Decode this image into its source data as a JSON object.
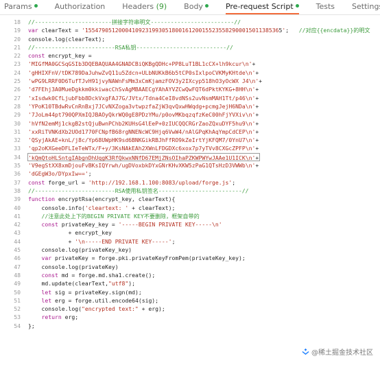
{
  "tabs": [
    {
      "label": "Params",
      "active": false,
      "dot": true
    },
    {
      "label": "Authorization",
      "active": false
    },
    {
      "label": "Headers",
      "count": "(9)",
      "active": false
    },
    {
      "label": "Body",
      "active": false,
      "dot": true
    },
    {
      "label": "Pre-request Script",
      "active": true,
      "dot": true
    },
    {
      "label": "Tests",
      "active": false
    },
    {
      "label": "Settings",
      "active": false
    }
  ],
  "code_lines": [
    {
      "n": 18,
      "parts": [
        [
          "cm",
          "//-----------------------拼接字符串明文-------------------------//"
        ]
      ]
    },
    {
      "n": 19,
      "parts": [
        [
          "kw",
          "var"
        ],
        [
          "",
          " clearText = "
        ],
        [
          "str",
          "'1554790512000410923199305180016120015523558290001501138536"
        ],
        [
          "",
          "5"
        ],
        [
          "str",
          "'"
        ],
        [
          "",
          ";   "
        ],
        [
          "cm",
          "//对应{{encdata}}的明文"
        ]
      ]
    },
    {
      "n": 20,
      "parts": [
        [
          "",
          "console.log(clearText);"
        ]
      ]
    },
    {
      "n": 21,
      "parts": [
        [
          "cm",
          "//------------------------RSA私钥---------------------------//"
        ]
      ]
    },
    {
      "n": 22,
      "parts": [
        [
          "kw",
          "const"
        ],
        [
          "",
          " encrypt_key ="
        ]
      ]
    },
    {
      "n": 23,
      "parts": [
        [
          "str",
          "'MIGfMA0GCSqGSIb3DQEBAQUAA4GNADCBiQKBgQDHc+PP8LuT1BL1cCX+lh9kcur\\n'"
        ],
        [
          "",
          "+"
        ]
      ]
    },
    {
      "n": 24,
      "parts": [
        [
          "str",
          "'gHHIXFnV/tDK789DaJuhwZvQ11u5Zdcn+ULbNUKkB6b5tCP0sIxlpoCVKMyKHtde\\n'"
        ],
        [
          "",
          "+"
        ]
      ]
    },
    {
      "n": 25,
      "parts": [
        [
          "str",
          "'wPG9LRRF0D6TufTJvH91jvyNAWnFsMm3xCmKjamzFOV3y2IXcyp518hO3yOcWX J4\\n'"
        ],
        [
          "",
          "+"
        ]
      ]
    },
    {
      "n": 26,
      "parts": [
        [
          "str",
          "'d7FEhj3A0MueDgkkm0kkiwacChSvAgMBAAECgYAhAYVZCwQwFQT6dPktKYKG+8HH\\n'"
        ],
        [
          "",
          "+"
        ]
      ]
    },
    {
      "n": 27,
      "parts": [
        [
          "str",
          "'xIsdwk0CfLjubFbb8DckVxgFAJ7G/JVtx/Tdna4CeI8vdNSs2uvNsmMAH1Tt/p46\\n'"
        ],
        [
          "",
          "+"
        ]
      ]
    },
    {
      "n": 28,
      "parts": [
        [
          "str",
          "'YPoK10TBdwRvCnRnBxj7JCvNXZoga3vtwpzfaZjW3qvQxwHWqdg+pcmgJejH6NDa\\n'"
        ],
        [
          "",
          "+"
        ]
      ]
    },
    {
      "n": 29,
      "parts": [
        [
          "str",
          "'7JoLm44pt790QPXmIQJBAOyQkrWQ0gE8PDzYMu/p0ovMKbqzqfzKeC00hFjYVXiv\\n'"
        ],
        [
          "",
          "+"
        ]
      ]
    },
    {
      "n": 30,
      "parts": [
        [
          "str",
          "'hVfN2emMj1ckgB2stQjuBwnPChb2KUHsG4lEeP+0zIUCQQCRGrZaoZQxuDYF5hu9\\n'"
        ],
        [
          "",
          "+"
        ]
      ]
    },
    {
      "n": 31,
      "parts": [
        [
          "str",
          "'xxRiTVNKdXb2UOd1770FCNpfB68rgNNENcWC9Hjq6VwW4/nAlGPqKhAqYmpCdCEP\\n'"
        ],
        [
          "",
          "+"
        ]
      ]
    },
    {
      "n": 32,
      "parts": [
        [
          "str",
          "'QSyjAkAE+knL/j8c/Yp68UWpHK9sd6BNKGikRBJhFfRO9kZeIrtYjKFQM7/0YnU7\\n'"
        ],
        [
          "",
          "+"
        ]
      ]
    },
    {
      "n": 33,
      "parts": [
        [
          "str",
          "'qp2oKXGeeDFLIeTeWTx/F+y/3KsNAkEAh2XWnLFDGDXc6xox7p7yTVv8CXGcZPFP\\n'"
        ],
        [
          "",
          "+"
        ]
      ]
    },
    {
      "n": 34,
      "hl": true,
      "parts": [
        [
          "str",
          "'kQmQtoHLSntgIAbgnDhUqgK3RfQkwxNNfD67EMjZNsOIhaPZKWPWYwJAAe1U1ICK\\n'"
        ],
        [
          "",
          "+"
        ]
      ]
    },
    {
      "n": 35,
      "parts": [
        [
          "str",
          "'V9egStXX8xmDjouFvBKsIQYrwh/ugDVoxbkDYxGNrKHvXKW5zPaG1QTsHzD3VWWb\\n'"
        ],
        [
          "",
          "+"
        ]
      ]
    },
    {
      "n": 36,
      "parts": [
        [
          "str",
          "'dGEgW3o/DYpxIw=='"
        ],
        [
          "",
          ";"
        ]
      ]
    },
    {
      "n": 37,
      "parts": [
        [
          "kw",
          "const"
        ],
        [
          "",
          " forge_url = "
        ],
        [
          "str",
          "'http://192.168.1.100:8083/upload/forge.js'"
        ],
        [
          "",
          ";"
        ]
      ]
    },
    {
      "n": 38,
      "parts": [
        [
          "cm",
          "//------------------------RSA使用私钥签名-------------------------//"
        ]
      ]
    },
    {
      "n": 39,
      "parts": [
        [
          "kw",
          "function"
        ],
        [
          "",
          " encryptRsa(encrypt_key, clearText){"
        ]
      ]
    },
    {
      "n": 40,
      "parts": [
        [
          "",
          "    console.info("
        ],
        [
          "str",
          "'cleartext: '"
        ],
        [
          "",
          " + clearText);"
        ]
      ]
    },
    {
      "n": 41,
      "parts": [
        [
          "",
          "    "
        ],
        [
          "cm",
          "//注意此处上下的BEGIN PRIVATE KEY不要删除，框架自带的"
        ]
      ]
    },
    {
      "n": 42,
      "parts": [
        [
          "",
          "    "
        ],
        [
          "kw",
          "const"
        ],
        [
          "",
          " privateKey_key = "
        ],
        [
          "str",
          "'-----BEGIN PRIVATE KEY-----\\n'"
        ]
      ]
    },
    {
      "n": 43,
      "parts": [
        [
          "",
          "            + encrypt_key"
        ]
      ]
    },
    {
      "n": 44,
      "parts": [
        [
          "",
          "            + "
        ],
        [
          "str",
          "'\\n-----END PRIVATE KEY-----'"
        ],
        [
          "",
          ";"
        ]
      ]
    },
    {
      "n": 45,
      "parts": [
        [
          "",
          "    console.log(privateKey_key)"
        ]
      ]
    },
    {
      "n": 46,
      "parts": [
        [
          "",
          "    "
        ],
        [
          "kw",
          "var"
        ],
        [
          "",
          " privateKey = forge.pki.privateKeyFromPem(privateKey_key);"
        ]
      ]
    },
    {
      "n": 47,
      "parts": [
        [
          "",
          "    console.log(privateKey)"
        ]
      ]
    },
    {
      "n": 48,
      "parts": [
        [
          "",
          "    "
        ],
        [
          "kw",
          "const"
        ],
        [
          "",
          " md = forge.md.sha1.create();"
        ]
      ]
    },
    {
      "n": 49,
      "parts": [
        [
          "",
          "    md.update(clearText,"
        ],
        [
          "str",
          "\"utf8\""
        ],
        [
          "",
          ");"
        ]
      ]
    },
    {
      "n": 50,
      "parts": [
        [
          "",
          "    "
        ],
        [
          "kw",
          "let"
        ],
        [
          "",
          " sig = privateKey.sign(md);"
        ]
      ]
    },
    {
      "n": 51,
      "parts": [
        [
          "",
          "    "
        ],
        [
          "kw",
          "let"
        ],
        [
          "",
          " erg = forge.util.encode64(sig);"
        ]
      ]
    },
    {
      "n": 52,
      "parts": [
        [
          "",
          "    console.log("
        ],
        [
          "str",
          "\"encrypted text:\""
        ],
        [
          "",
          " + erg);"
        ]
      ]
    },
    {
      "n": 53,
      "parts": [
        [
          "",
          "    "
        ],
        [
          "kw",
          "return"
        ],
        [
          "",
          " erg;"
        ]
      ]
    },
    {
      "n": 54,
      "parts": [
        [
          "",
          "};"
        ]
      ]
    }
  ],
  "watermark": {
    "text": "@稀土掘金技术社区",
    "icon": "juejin-logo-icon"
  },
  "colors": {
    "active_tab_underline": "#f26b3a",
    "dot": "#2fa84f",
    "keyword": "#a8168d",
    "string": "#b32d1e",
    "comment": "#3b9a3b"
  }
}
